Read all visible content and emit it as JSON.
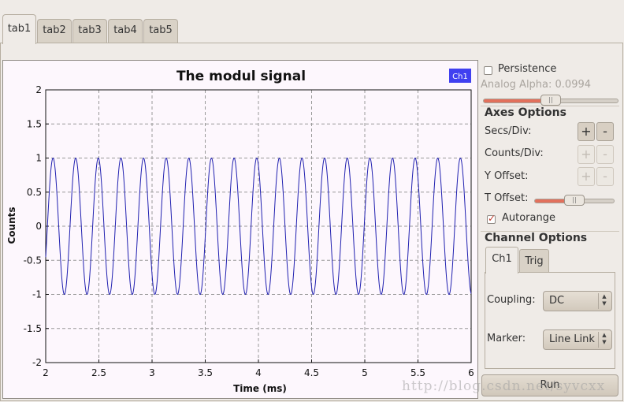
{
  "tabs": [
    "tab1",
    "tab2",
    "tab3",
    "tab4",
    "tab5"
  ],
  "active_tab": 0,
  "controls": {
    "persistence_label": "Persistence",
    "persistence_checked": false,
    "analog_alpha_label": "Analog Alpha: 0.0994",
    "analog_alpha_fraction": 0.5,
    "axes_options_title": "Axes Options",
    "secs_div_label": "Secs/Div:",
    "counts_div_label": "Counts/Div:",
    "y_offset_label": "Y Offset:",
    "t_offset_label": "T Offset:",
    "t_offset_fraction": 0.5,
    "plus_label": "+",
    "minus_label": "-",
    "autorange_label": "Autorange",
    "autorange_checked": true,
    "channel_options_title": "Channel Options",
    "channel_tabs": [
      "Ch1",
      "Trig"
    ],
    "coupling_label": "Coupling:",
    "coupling_value": "DC",
    "marker_label": "Marker:",
    "marker_value": "Line Link",
    "run_label": "Run"
  },
  "watermark": "http://blog.csdn.net/syvcxx",
  "chart_data": {
    "type": "line",
    "title": "The modul signal",
    "xlabel": "Time (ms)",
    "ylabel": "Counts",
    "legend": [
      "Ch1"
    ],
    "legend_color": "#4040f0",
    "series_color": "#2020b0",
    "xlim": [
      2,
      6
    ],
    "ylim": [
      -2,
      2
    ],
    "xticks": [
      "2",
      "2.5",
      "3",
      "3.5",
      "4",
      "4.5",
      "5",
      "5.5",
      "6"
    ],
    "yticks": [
      "2",
      "1.5",
      "1",
      "0.5",
      "0",
      "-0.5",
      "-1",
      "-1.5",
      "-2"
    ],
    "grid": true,
    "series": [
      {
        "name": "Ch1",
        "signal": "sinusoid",
        "amplitude": 1,
        "frequency_per_ms": 4.7,
        "phase": 3.3,
        "x_start": 2,
        "x_end": 6
      }
    ]
  }
}
